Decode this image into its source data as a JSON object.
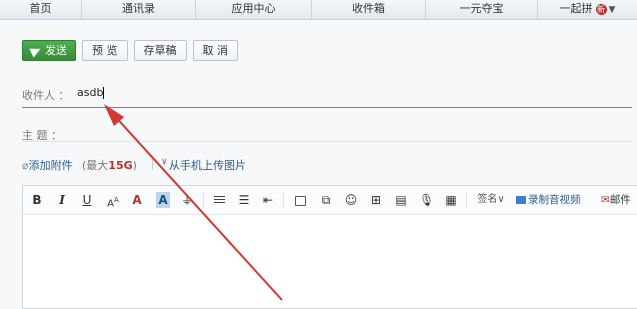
{
  "nav": {
    "tabs": [
      {
        "label": "首页"
      },
      {
        "label": "通讯录"
      },
      {
        "label": "应用中心"
      },
      {
        "label": "收件箱"
      },
      {
        "label": "一元夺宝"
      },
      {
        "label": "一起拼",
        "badge": "新"
      }
    ]
  },
  "toolbar": {
    "send_label": "发送",
    "preview_label": "预 览",
    "draft_label": "存草稿",
    "cancel_label": "取 消"
  },
  "recipients": {
    "label": "收件人 ：",
    "value": "asdb"
  },
  "subject": {
    "label": "主  题 ："
  },
  "attach": {
    "add_label": "添加附件",
    "max_prefix": "(最大",
    "max_size": "15G",
    "max_suffix": ")",
    "phone_upload_label": "从手机上传图片"
  },
  "editor_toolbar": {
    "bold": "B",
    "italic": "I",
    "underline": "U",
    "font_size": "A^A",
    "font_color": "A",
    "highlight": "A",
    "signature_label": "签名",
    "record_label": "录制音视频",
    "mail_label": "邮件"
  },
  "annotation": {
    "arrow_color": "#d6362e"
  }
}
